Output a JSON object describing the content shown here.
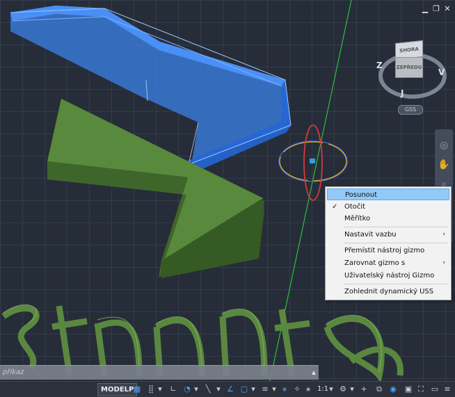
{
  "window_controls": {
    "minimize": "▁",
    "restore": "❐",
    "close": "✕"
  },
  "viewcube": {
    "top_face": "SHORA",
    "front_face": "ZEPŘEDU",
    "dir_west": "Z",
    "dir_east": "V",
    "dir_south": "J",
    "ucs_label": "GSS"
  },
  "context_menu": {
    "items": [
      {
        "label": "Posunout",
        "highlighted": true,
        "checked": false,
        "submenu": false
      },
      {
        "label": "Otočit",
        "highlighted": false,
        "checked": true,
        "submenu": false
      },
      {
        "label": "Měřítko",
        "highlighted": false,
        "checked": false,
        "submenu": false
      },
      {
        "label": "Nastavit vazbu",
        "highlighted": false,
        "checked": false,
        "submenu": true
      },
      {
        "label": "Přemístit nástroj gizmo",
        "highlighted": false,
        "checked": false,
        "submenu": false
      },
      {
        "label": "Zarovnat gizmo s",
        "highlighted": false,
        "checked": false,
        "submenu": true
      },
      {
        "label": "Uživatelský nástroj Gizmo",
        "highlighted": false,
        "checked": false,
        "submenu": false
      },
      {
        "label": "Zohlednit dynamický USS",
        "highlighted": false,
        "checked": false,
        "submenu": false
      }
    ],
    "check_glyph": "✓",
    "submenu_glyph": "›"
  },
  "command_line": {
    "placeholder": "příkaz",
    "expand_glyph": "▲"
  },
  "statusbar": {
    "model_label": "MODELP",
    "scale_label": "1:1",
    "icons": [
      "grid-icon",
      "snap-icon",
      "dropdown-icon",
      "ortho-icon",
      "polar-icon",
      "dropdown-icon",
      "isodraft-icon",
      "dropdown-icon",
      "osnap-track-icon",
      "osnap-icon",
      "dropdown-icon",
      "lineweight-icon",
      "dropdown-icon",
      "annotation-visibility-icon",
      "auto-scale-icon",
      "annotation-scale-icon",
      "workspace-gear-icon",
      "dropdown-icon",
      "add-icon",
      "isolate-icon",
      "hardware-accel-icon",
      "quick-properties-icon",
      "fullscreen-icon",
      "customize-icon"
    ]
  },
  "colors": {
    "viewport_bg": "#262d39",
    "blue_selected": "#2f7cf0",
    "green_solid": "#4c7a34",
    "menu_highlight": "#91c9f7"
  }
}
